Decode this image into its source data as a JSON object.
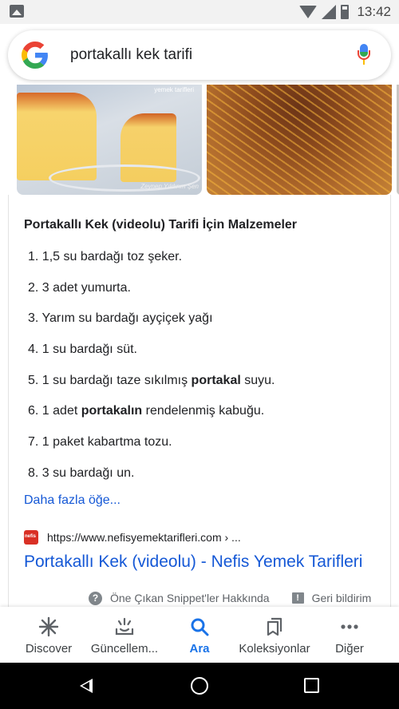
{
  "status_bar": {
    "time": "13:42"
  },
  "search": {
    "query": "portakallı kek tarifi"
  },
  "images": {
    "watermark": "yemek tarifleri",
    "signature": "Zeynep Yıldırım Şen"
  },
  "card": {
    "title": "Portakallı Kek (videolu) Tarifi İçin Malzemeler",
    "ingredients": [
      {
        "num": "1.",
        "pre": "1,5 su bardağı toz şeker.",
        "bold": "",
        "post": ""
      },
      {
        "num": "2.",
        "pre": "3 adet yumurta.",
        "bold": "",
        "post": ""
      },
      {
        "num": "3.",
        "pre": "Yarım su bardağı ayçiçek yağı",
        "bold": "",
        "post": ""
      },
      {
        "num": "4.",
        "pre": "1 su bardağı süt.",
        "bold": "",
        "post": ""
      },
      {
        "num": "5.",
        "pre": "1 su bardağı taze sıkılmış ",
        "bold": "portakal",
        "post": " suyu."
      },
      {
        "num": "6.",
        "pre": "1 adet ",
        "bold": "portakalın",
        "post": " rendelenmiş kabuğu."
      },
      {
        "num": "7.",
        "pre": "1 paket kabartma tozu.",
        "bold": "",
        "post": ""
      },
      {
        "num": "8.",
        "pre": "3 su bardağı un.",
        "bold": "",
        "post": ""
      }
    ],
    "more_link": "Daha fazla öğe...",
    "source_url": "https://www.nefisyemektarifleri.com › ...",
    "result_title": "Portakallı Kek (videolu) - Nefis Yemek Tarifleri",
    "snippet_about": "Öne Çıkan Snippet'ler Hakkında",
    "feedback": "Geri bildirim"
  },
  "bottom_nav": {
    "items": [
      {
        "label": "Discover",
        "icon": "asterisk-icon"
      },
      {
        "label": "Güncellem...",
        "icon": "updates-tray-icon"
      },
      {
        "label": "Ara",
        "icon": "search-icon"
      },
      {
        "label": "Koleksiyonlar",
        "icon": "collections-icon"
      },
      {
        "label": "Diğer",
        "icon": "more-dots-icon"
      }
    ]
  },
  "colors": {
    "link": "#1558d6",
    "active_tab": "#1a73e8",
    "text": "#202124",
    "muted": "#5f6368"
  }
}
